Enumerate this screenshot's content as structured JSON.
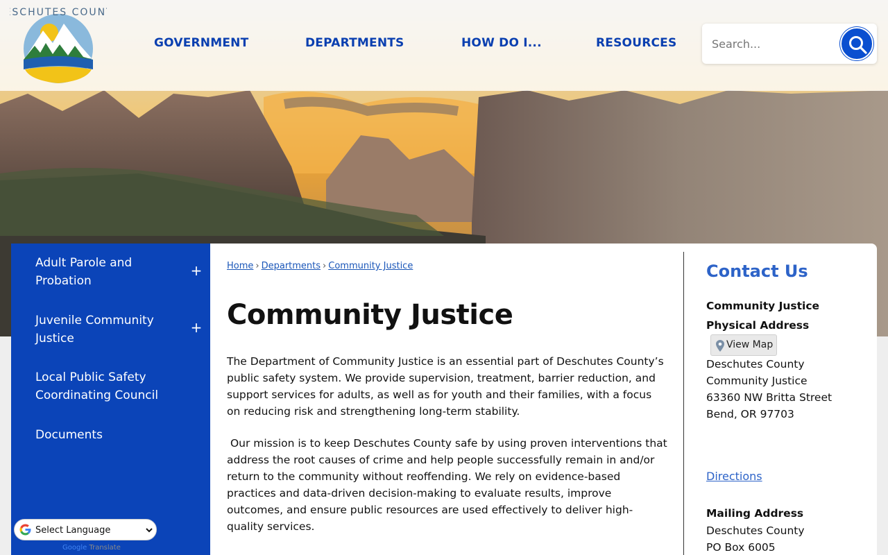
{
  "logo": {
    "name": "DESCHUTES COUNTY"
  },
  "nav": {
    "items": [
      {
        "label": "GOVERNMENT"
      },
      {
        "label": "DEPARTMENTS"
      },
      {
        "label": "HOW DO I..."
      },
      {
        "label": "RESOURCES"
      }
    ]
  },
  "search": {
    "placeholder": "Search...",
    "icon": "search-icon"
  },
  "sidebar": {
    "items": [
      {
        "label": "Adult Parole and Probation",
        "expand": "+"
      },
      {
        "label": "Juvenile Community Justice",
        "expand": "+"
      },
      {
        "label": "Local Public Safety Coordinating Council"
      },
      {
        "label": "Documents"
      }
    ]
  },
  "breadcrumb": {
    "items": [
      "Home",
      "Departments",
      "Community Justice"
    ],
    "separator": "›"
  },
  "main": {
    "title": "Community Justice",
    "paragraphs": [
      "The Department of Community Justice is an essential part of Deschutes County’s public safety system. We provide supervision, treatment, barrier reduction, and support services for adults, as well as for youth and their families, with a focus on reducing risk and strengthening long-term stability.",
      " Our mission is to keep Deschutes County safe by using proven interventions that address the root causes of crime and help people successfully remain in and/or return to the community without reoffending. We rely on evidence-based practices and data-driven decision-making to evaluate results, improve outcomes, and ensure public resources are used effectively to deliver high-quality services."
    ]
  },
  "contact": {
    "title": "Contact Us",
    "department": "Community Justice",
    "physical_label": "Physical Address",
    "map_button": "View Map",
    "physical_lines": [
      "Deschutes County",
      "Community Justice",
      "63360 NW Britta Street",
      "Bend, OR 97703"
    ],
    "directions": "Directions",
    "mailing_label": "Mailing Address",
    "mailing_lines": [
      "Deschutes County",
      "PO Box 6005"
    ]
  },
  "translate": {
    "select_label": "Select Language",
    "powered_prefix": "Google",
    "powered_suffix": "Translate"
  },
  "colors": {
    "brand_blue": "#0a3fb0",
    "sidebar_blue": "#0b44b8",
    "link_blue": "#2d63c8"
  }
}
